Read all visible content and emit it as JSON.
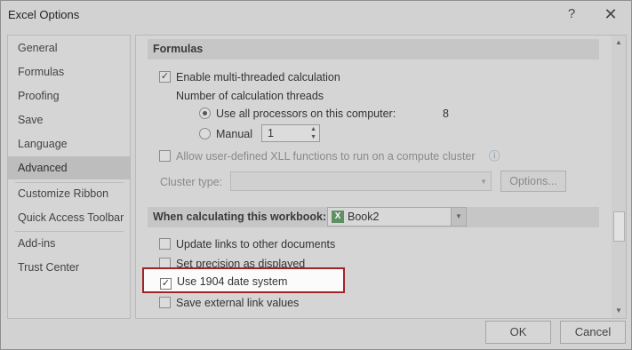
{
  "window": {
    "title": "Excel Options",
    "help_glyph": "?",
    "close_glyph": "✕"
  },
  "sidebar": {
    "items": [
      {
        "label": "General"
      },
      {
        "label": "Formulas"
      },
      {
        "label": "Proofing"
      },
      {
        "label": "Save"
      },
      {
        "label": "Language"
      },
      {
        "label": "Advanced",
        "selected": true
      },
      {
        "label": "Customize Ribbon"
      },
      {
        "label": "Quick Access Toolbar"
      },
      {
        "label": "Add-ins"
      },
      {
        "label": "Trust Center"
      }
    ]
  },
  "formulas": {
    "heading": "Formulas",
    "multithread": {
      "label": "Enable multi-threaded calculation",
      "checked": true
    },
    "threads_label": "Number of calculation threads",
    "use_all": {
      "label": "Use all processors on this computer:",
      "value": "8",
      "selected": true
    },
    "manual": {
      "label": "Manual",
      "value": "1",
      "selected": false
    },
    "xll": {
      "label": "Allow user-defined XLL functions to run on a compute cluster",
      "info_glyph": "ⓘ",
      "checked": false
    },
    "cluster": {
      "label": "Cluster type:",
      "value": "",
      "options_button": "Options..."
    }
  },
  "workbook": {
    "heading": "When calculating this workbook:",
    "selected": "Book2",
    "update_links": {
      "label": "Update links to other documents",
      "checked": false
    },
    "precision": {
      "label": "Set precision as displayed",
      "checked": false
    },
    "date1904": {
      "label": "Use 1904 date system",
      "checked": true
    },
    "save_links": {
      "label": "Save external link values",
      "checked": false
    }
  },
  "footer": {
    "ok": "OK",
    "cancel": "Cancel"
  },
  "colors": {
    "highlight_border": "#a3222a",
    "excel_green": "#5e9063"
  }
}
